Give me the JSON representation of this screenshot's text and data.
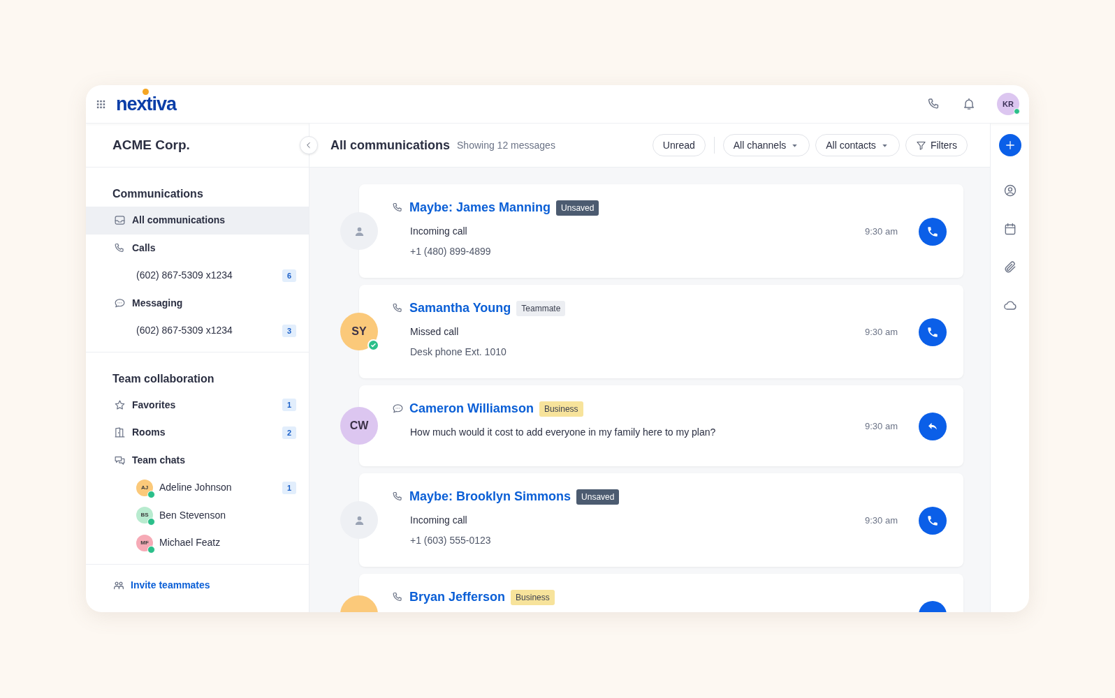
{
  "app": {
    "logo": "nextiva",
    "user": {
      "initials": "KR",
      "color": "#dcc6f0",
      "online": true
    }
  },
  "sidebar": {
    "org": "ACME Corp.",
    "sections": [
      {
        "title": "Communications",
        "items": [
          {
            "label": "All communications",
            "selected": true
          },
          {
            "label": "Calls",
            "selected": false,
            "children": [
              {
                "label": "(602) 867-5309 x1234",
                "count": "6",
                "selected": false
              }
            ]
          },
          {
            "label": "Messaging",
            "selected": false,
            "children": [
              {
                "label": "(602) 867-5309 x1234",
                "count": "3",
                "selected": false
              }
            ]
          }
        ]
      },
      {
        "title": "Team collaboration",
        "items": [
          {
            "label": "Favorites",
            "count": "1",
            "selected": false
          },
          {
            "label": "Rooms",
            "count": "2",
            "selected": false
          },
          {
            "label": "Team chats",
            "selected": false,
            "children": [
              {
                "label": "Adeline Johnson",
                "avatar": {
                  "initials": "AJ",
                  "color": "#fbc97a",
                  "online": true
                },
                "count": "1",
                "selected": false
              },
              {
                "label": "Ben Stevenson",
                "avatar": {
                  "initials": "BS",
                  "color": "#b8ebcf",
                  "online": true
                },
                "selected": false
              },
              {
                "label": "Michael Featz",
                "avatar": {
                  "initials": "MF",
                  "color": "#f6aab6",
                  "online": true
                },
                "selected": false
              }
            ]
          }
        ]
      }
    ],
    "invite": "Invite teammates"
  },
  "toolbar": {
    "title": "All communications",
    "subtitle": "Showing 12 messages",
    "filters": [
      {
        "label": "Unread",
        "kind": "toggle"
      },
      {
        "label": "All channels",
        "kind": "dropdown"
      },
      {
        "label": "All contacts",
        "kind": "dropdown"
      },
      {
        "label": "Filters",
        "kind": "filter"
      }
    ]
  },
  "messages": [
    {
      "kind": "call",
      "avatar": {
        "kind": "placeholder"
      },
      "name": "Maybe: James Manning",
      "tag": {
        "label": "Unsaved",
        "color": "#4c5b70"
      },
      "lines": [
        "Incoming call",
        "+1 (480) 899-4899"
      ],
      "time": "9:30 am"
    },
    {
      "kind": "call",
      "avatar": {
        "kind": "initials",
        "initials": "SY",
        "color": "#fbc97a",
        "online": true
      },
      "name": "Samantha Young",
      "tag": {
        "label": "Teammate",
        "color": "#eceef2"
      },
      "lines": [
        "Missed call",
        "Desk phone Ext. 1010"
      ],
      "time": "9:30 am"
    },
    {
      "kind": "message",
      "avatar": {
        "kind": "initials",
        "initials": "CW",
        "color": "#dcc6f0"
      },
      "name": "Cameron Williamson",
      "tag": {
        "label": "Business",
        "color": "#f7e39b"
      },
      "lines": [
        "How much would it cost to add everyone in my family here to my plan?"
      ],
      "time": "9:30 am"
    },
    {
      "kind": "call",
      "avatar": {
        "kind": "placeholder"
      },
      "name": "Maybe: Brooklyn Simmons",
      "tag": {
        "label": "Unsaved",
        "color": "#4c5b70"
      },
      "lines": [
        "Incoming call",
        "+1 (603) 555-0123"
      ],
      "time": "9:30 am"
    },
    {
      "kind": "call",
      "avatar": {
        "kind": "initials",
        "color": "#fbc97a"
      },
      "name": "Bryan Jefferson",
      "tag": {
        "label": "Business",
        "color": "#f7e39b"
      }
    }
  ]
}
